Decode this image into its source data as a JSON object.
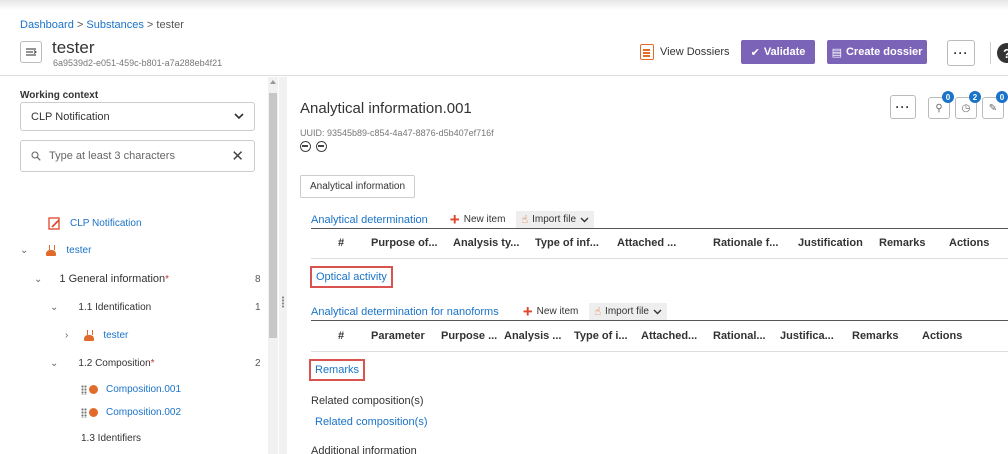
{
  "header": {
    "breadcrumb": {
      "dashboard": "Dashboard",
      "sep1": " > ",
      "substances": "Substances",
      "sep2": " > ",
      "current": "tester"
    },
    "title": "tester",
    "subtitle": "6a9539d2-e051-459c-b801-a7a288eb4f21",
    "view_dossiers": "View Dossiers",
    "validate": "Validate",
    "create_dossier": "Create dossier",
    "more": "···",
    "help": "?"
  },
  "sidebar": {
    "context_label": "Working context",
    "context_value": "CLP Notification",
    "search_placeholder": "Type at least 3 characters",
    "tree": {
      "clp": "CLP Notification",
      "tester_root": "tester",
      "general_info": "1 General information",
      "general_info_count": "8",
      "identification": "1.1 Identification",
      "identification_count": "1",
      "tester_child": "tester",
      "composition": "1.2 Composition",
      "composition_count": "2",
      "composition1": "Composition.001",
      "composition2": "Composition.002",
      "identifiers": "1.3 Identifiers"
    }
  },
  "main": {
    "title": "Analytical information.001",
    "uuid": "UUID: 93545b89-c854-4a47-8876-d5b407ef716f",
    "more": "···",
    "badges": [
      "0",
      "2",
      "0"
    ],
    "tab": "Analytical information",
    "sections": {
      "analytical_determination": {
        "title": "Analytical determination",
        "new_item": "New item",
        "import_file": "Import file",
        "columns": [
          "#",
          "Purpose of...",
          "Analysis ty...",
          "Type of inf...",
          "Attached ...",
          "Rationale f...",
          "Justification",
          "Remarks",
          "Actions"
        ]
      },
      "optical_activity": "Optical activity",
      "nanoforms": {
        "title": "Analytical determination for nanoforms",
        "new_item": "New item",
        "import_file": "Import file",
        "columns": [
          "#",
          "Parameter",
          "Purpose ...",
          "Analysis ...",
          "Type of i...",
          "Attached...",
          "Rational...",
          "Justifica...",
          "Remarks",
          "Actions"
        ]
      },
      "remarks": "Remarks",
      "related_label": "Related composition(s)",
      "related_link": "Related composition(s)",
      "additional": "Additional information"
    }
  },
  "colors": {
    "accent": "#1a73c8",
    "purple": "#7b63b7",
    "orange": "#e06b2b",
    "highlight": "#d9534f"
  }
}
